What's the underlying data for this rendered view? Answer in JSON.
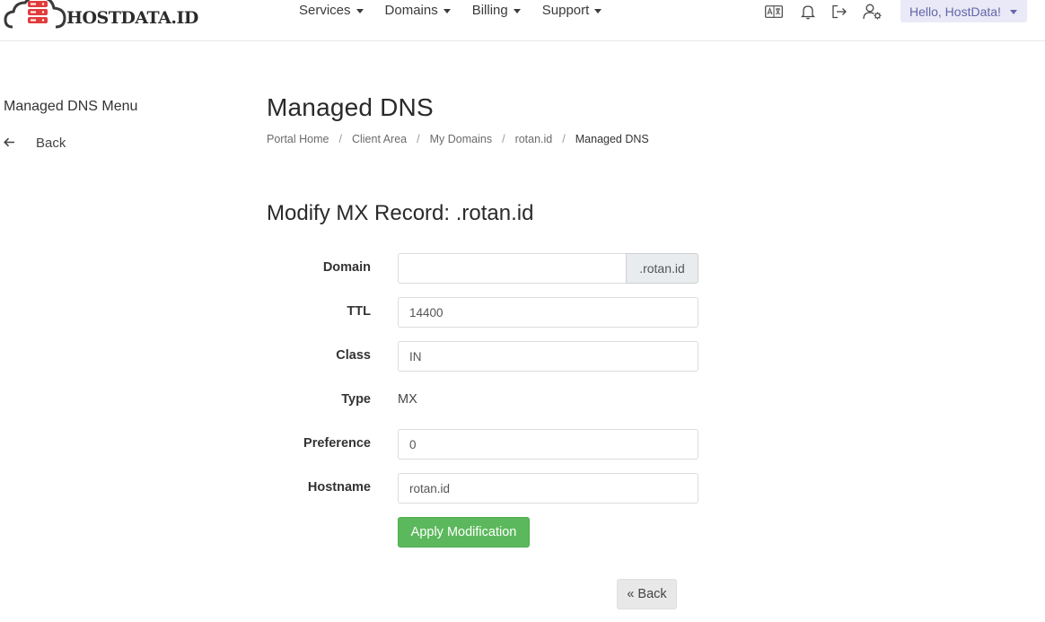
{
  "header": {
    "logo_text": "HOSTDATA.ID",
    "nav": [
      {
        "label": "Services"
      },
      {
        "label": "Domains"
      },
      {
        "label": "Billing"
      },
      {
        "label": "Support"
      }
    ],
    "icons": [
      "translate-icon",
      "bell-icon",
      "logout-icon",
      "user-settings-icon"
    ],
    "user_menu_label": "Hello, HostData!"
  },
  "sidebar": {
    "title": "Managed DNS Menu",
    "back_label": "Back"
  },
  "main": {
    "page_title": "Managed DNS",
    "breadcrumb": [
      {
        "label": "Portal Home"
      },
      {
        "label": "Client Area"
      },
      {
        "label": "My Domains"
      },
      {
        "label": "rotan.id"
      },
      {
        "label": "Managed DNS"
      }
    ],
    "section_title": "Modify MX Record: .rotan.id",
    "form": {
      "domain_label": "Domain",
      "domain_value": "",
      "domain_suffix": ".rotan.id",
      "ttl_label": "TTL",
      "ttl_value": "14400",
      "class_label": "Class",
      "class_value": "IN",
      "type_label": "Type",
      "type_value": "MX",
      "preference_label": "Preference",
      "preference_value": "0",
      "hostname_label": "Hostname",
      "hostname_value": "rotan.id"
    },
    "apply_label": "Apply Modification",
    "back_label": "« Back"
  },
  "colors": {
    "brand_red": "#e23b3b",
    "apply_green": "#5cb85c",
    "user_menu_bg": "#e9e9f7",
    "user_menu_text": "#6366a8"
  }
}
